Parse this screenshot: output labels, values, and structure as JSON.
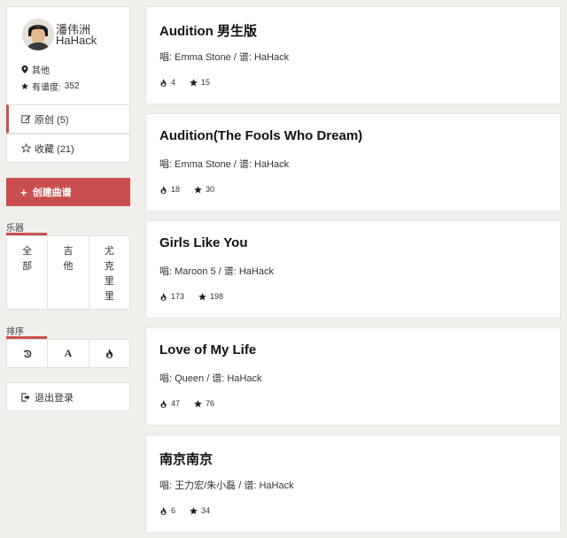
{
  "profile": {
    "name_zh": "潘伟洲",
    "name_en": "HaHack",
    "location": "其他",
    "score_label": "有谱度:",
    "score_value": "352"
  },
  "tabs": [
    {
      "label": "原创 (5)",
      "icon": "edit-icon",
      "active": true
    },
    {
      "label": "收藏 (21)",
      "icon": "star-outline-icon",
      "active": false
    }
  ],
  "create_button": {
    "label": "创建曲谱",
    "icon": "plus-icon"
  },
  "instrument_filter": {
    "label": "乐器",
    "options": [
      "全部",
      "吉他",
      "尤克里里"
    ]
  },
  "sort": {
    "label": "排序",
    "options": [
      {
        "icon": "history-icon"
      },
      {
        "icon": "alphabet-icon",
        "text": "A"
      },
      {
        "icon": "fire-icon"
      }
    ]
  },
  "logout": {
    "label": "退出登录",
    "icon": "logout-icon"
  },
  "scores": [
    {
      "title": "Audition 男生版",
      "meta": "唱:  Emma Stone / 谱:  HaHack",
      "views": "4",
      "stars": "15"
    },
    {
      "title": "Audition(The Fools Who Dream)",
      "meta": "唱:  Emma Stone / 谱:  HaHack",
      "views": "18",
      "stars": "30"
    },
    {
      "title": "Girls Like You",
      "meta": "唱:  Maroon 5 / 谱:  HaHack",
      "views": "173",
      "stars": "198"
    },
    {
      "title": "Love of My Life",
      "meta": "唱:  Queen / 谱:  HaHack",
      "views": "47",
      "stars": "76"
    },
    {
      "title": "南京南京",
      "meta": "唱:  王力宏/朱小磊 / 谱:  HaHack",
      "views": "6",
      "stars": "34"
    }
  ],
  "colors": {
    "accent": "#c94f4f",
    "background": "#f0efec"
  }
}
